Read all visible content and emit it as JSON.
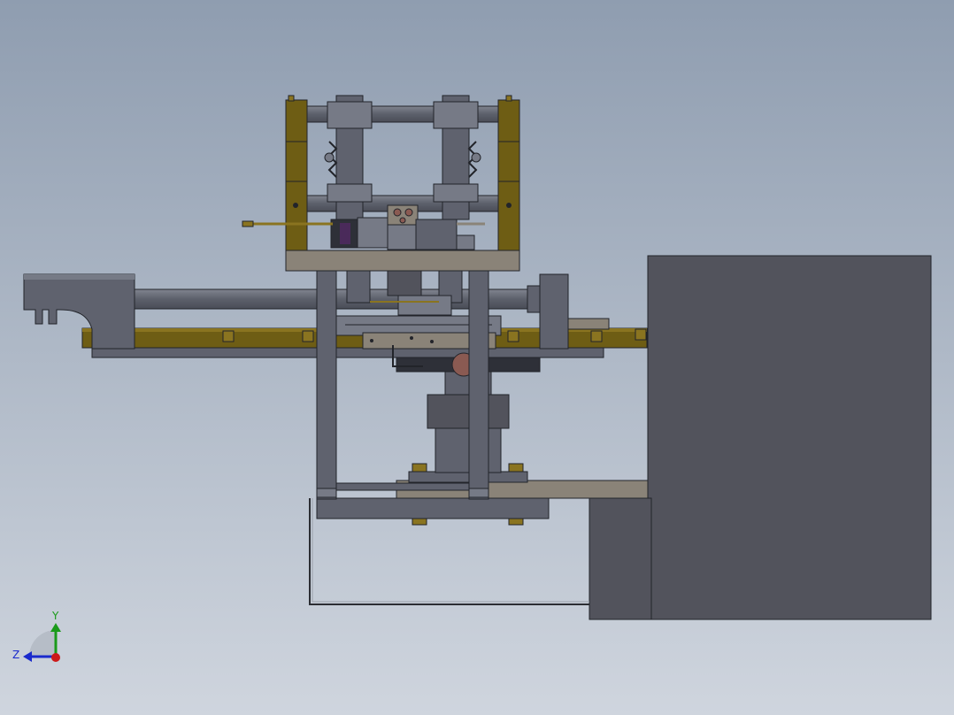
{
  "viewport": {
    "background_top": "#8f9db0",
    "background_bottom": "#cfd5de"
  },
  "colors": {
    "plate_dark": "#52535c",
    "plate_mid": "#5f626e",
    "plate_light": "#767a86",
    "beige": "#8a8378",
    "olive": "#6e5d14",
    "olive_light": "#8a7420",
    "shaft": "#6f7380",
    "edge": "#22242a",
    "copper": "#8a5a52",
    "purple": "#4a2a5a"
  },
  "triad": {
    "y_label": "Y",
    "z_label": "Z",
    "y_color": "#1a9a1a",
    "z_color": "#1a2acc",
    "origin_color": "#cc1a1a"
  }
}
